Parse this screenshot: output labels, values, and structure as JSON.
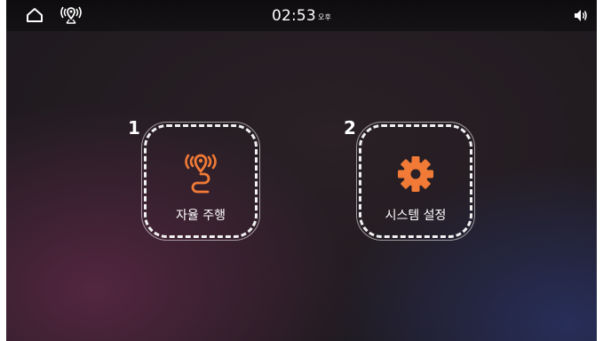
{
  "status_bar": {
    "time": "02:53",
    "ampm": "오후"
  },
  "tiles": [
    {
      "number": "1",
      "label": "자율 주행",
      "icon": "autonomous-driving-icon"
    },
    {
      "number": "2",
      "label": "시스템 설정",
      "icon": "gear-icon"
    }
  ],
  "colors": {
    "accent": "#f07a36",
    "tile_border": "#f2f2f2",
    "status_bar": "#121012"
  }
}
